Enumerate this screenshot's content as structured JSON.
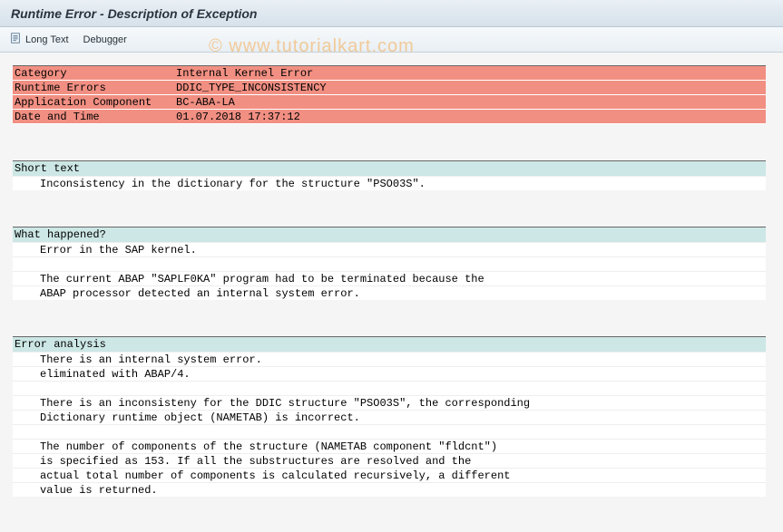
{
  "title": "Runtime Error - Description of Exception",
  "toolbar": {
    "long_text": "Long Text",
    "debugger": "Debugger"
  },
  "watermark": "© www.tutorialkart.com",
  "header": {
    "rows": [
      {
        "label": "Category",
        "value": "Internal Kernel Error"
      },
      {
        "label": "Runtime Errors",
        "value": "DDIC_TYPE_INCONSISTENCY"
      },
      {
        "label": "Application Component",
        "value": "BC-ABA-LA"
      },
      {
        "label": "Date and Time",
        "value": "01.07.2018 17:37:12"
      }
    ]
  },
  "sections": [
    {
      "title": "Short text",
      "lines": [
        "Inconsistency in the dictionary for the structure \"PSO03S\"."
      ]
    },
    {
      "title": "What happened?",
      "lines": [
        "Error in the SAP kernel.",
        "",
        "The current ABAP \"SAPLF0KA\" program had to be terminated because the",
        "ABAP processor detected an internal system error."
      ]
    },
    {
      "title": "Error analysis",
      "lines": [
        "There is an internal system error.",
        "eliminated with ABAP/4.",
        "",
        "There is an inconsisteny for the DDIC structure \"PSO03S\", the corresponding",
        "Dictionary runtime object (NAMETAB) is incorrect.",
        "",
        "The number of components of the structure (NAMETAB component \"fldcnt\")",
        "is specified as 153. If all the substructures are resolved and the",
        "actual total number of components is calculated recursively, a different",
        "value is returned."
      ]
    }
  ]
}
